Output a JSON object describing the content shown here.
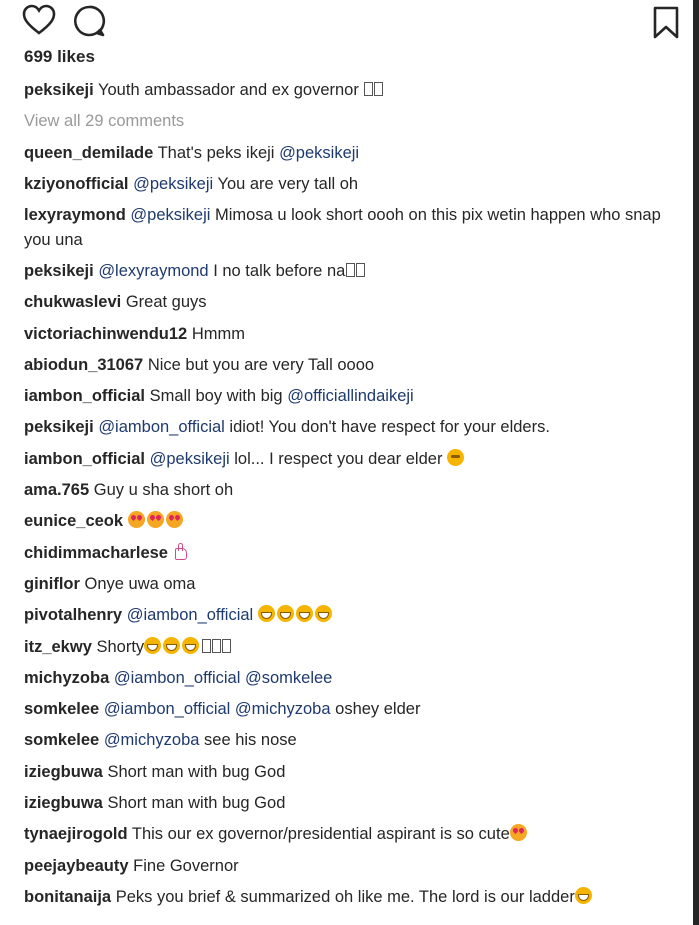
{
  "likes_label": "699 likes",
  "view_all_label": "View all 29 comments",
  "icons": {
    "like": "heart-outline-icon",
    "comment": "comment-bubble-icon",
    "save": "bookmark-icon"
  },
  "caption": {
    "user": "peksikeji",
    "text": "Youth ambassador and ex governor"
  },
  "comments": [
    {
      "user": "queen_demilade",
      "text": "That's peks ikeji",
      "mention": "@peksikeji"
    },
    {
      "user": "kziyonofficial",
      "mention": "@peksikeji",
      "text": "You are very tall oh"
    },
    {
      "user": "lexyraymond",
      "mention": "@peksikeji",
      "text": "Mimosa u look short oooh on this pix wetin happen who snap you una"
    },
    {
      "user": "peksikeji",
      "mention": "@lexyraymond",
      "text": "I no talk before na"
    },
    {
      "user": "chukwaslevi",
      "text": "Great guys"
    },
    {
      "user": "victoriachinwendu12",
      "text": "Hmmm"
    },
    {
      "user": "abiodun_31067",
      "text": "Nice but you are very Tall oooo"
    },
    {
      "user": "iambon_official",
      "text": "Small boy with big",
      "mention": "@officiallindaikeji"
    },
    {
      "user": "peksikeji",
      "mention": "@iambon_official",
      "text": "idiot! You don't have respect for your elders."
    },
    {
      "user": "iambon_official",
      "mention": "@peksikeji",
      "text": "lol... I respect you dear elder"
    },
    {
      "user": "ama.765",
      "text": "Guy u sha short oh"
    },
    {
      "user": "eunice_ceok",
      "text": ""
    },
    {
      "user": "chidimmacharlese",
      "text": ""
    },
    {
      "user": "giniflor",
      "text": "Onye uwa oma"
    },
    {
      "user": "pivotalhenry",
      "mention": "@iambon_official",
      "text": ""
    },
    {
      "user": "itz_ekwy",
      "text": "Shorty"
    },
    {
      "user": "michyzoba",
      "mention": "@iambon_official",
      "mention2": "@somkelee"
    },
    {
      "user": "somkelee",
      "mention": "@iambon_official",
      "mention2": "@michyzoba",
      "text": "oshey elder"
    },
    {
      "user": "somkelee",
      "mention": "@michyzoba",
      "text": "see his nose"
    },
    {
      "user": "iziegbuwa",
      "text": "Short man with bug God"
    },
    {
      "user": "iziegbuwa",
      "text": "Short man with bug God"
    },
    {
      "user": "tynaejirogold",
      "text": "This our ex governor/presidential aspirant is so cute"
    },
    {
      "user": "peejaybeauty",
      "text": "Fine Governor"
    },
    {
      "user": "bonitanaija",
      "text": "Peks you brief & summarized oh like me. The lord is our ladder"
    }
  ]
}
